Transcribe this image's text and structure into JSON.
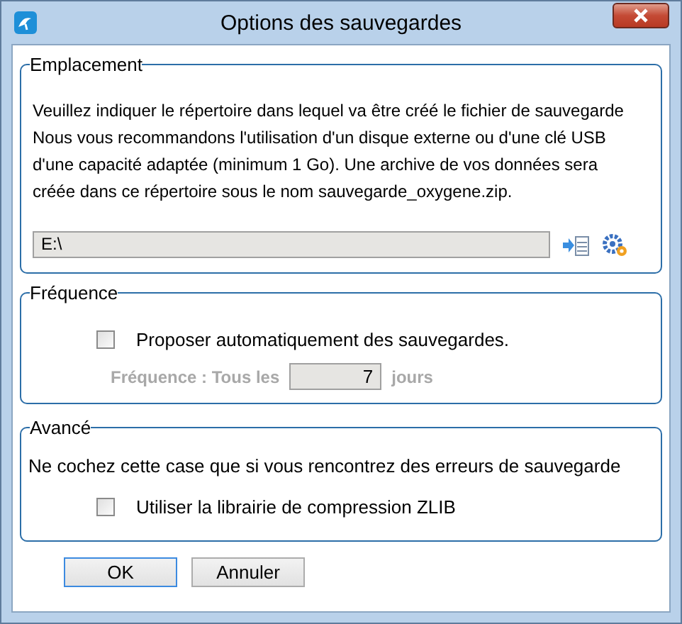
{
  "window": {
    "title": "Options des sauvegardes"
  },
  "location": {
    "legend": "Emplacement",
    "description": [
      "Veuillez indiquer le répertoire dans lequel va être créé le fichier de sauvegarde",
      "Nous vous recommandons l'utilisation d'un disque externe ou d'une clé USB",
      "d'une capacité adaptée (minimum 1 Go). Une archive de vos données sera",
      "créée dans ce répertoire sous le nom sauvegarde_oxygene.zip."
    ],
    "path": "E:\\"
  },
  "frequency": {
    "legend": "Fréquence",
    "auto": {
      "label": "Proposer automatiquement des sauvegardes.",
      "checked": false
    },
    "interval": {
      "label": "Fréquence : Tous les",
      "value": "7",
      "unit": "jours",
      "disabled": true
    }
  },
  "advanced": {
    "legend": "Avancé",
    "note": "Ne cochez cette case que si vous rencontrez des erreurs de sauvegarde",
    "zlib": {
      "label": "Utiliser la librairie de compression ZLIB",
      "checked": false
    }
  },
  "buttons": [
    {
      "label": "OK",
      "selected": true
    },
    {
      "label": "Annuler",
      "selected": false
    }
  ]
}
